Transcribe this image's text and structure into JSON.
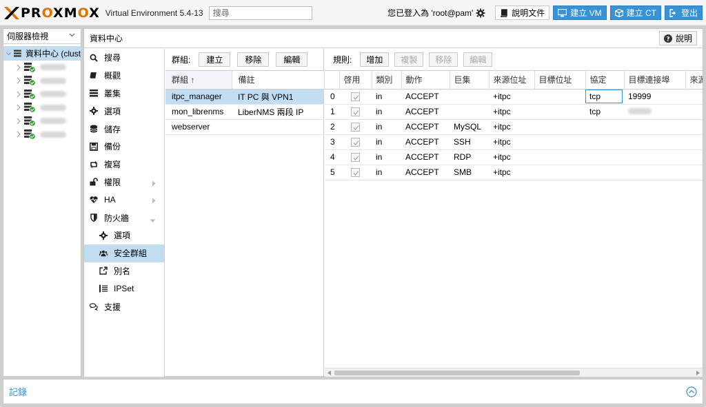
{
  "header": {
    "logo_pre": "PR",
    "logo_o1": "O",
    "logo_mid": "XM",
    "logo_o2": "O",
    "logo_post": "X",
    "version": "Virtual Environment 5.4-13",
    "search_placeholder": "搜尋",
    "user_text": "您已登入為 'root@pam'",
    "docs_label": "說明文件",
    "create_vm_label": "建立 VM",
    "create_ct_label": "建立 CT",
    "logout_label": "登出"
  },
  "tree": {
    "view": "伺服器檢視",
    "root_label": "資料中心 (clust",
    "node_count": 6
  },
  "content": {
    "title": "資料中心",
    "help_label": "說明"
  },
  "menu": [
    {
      "label": "搜尋",
      "icon": "search-icon",
      "sub": false,
      "active": false
    },
    {
      "label": "概觀",
      "icon": "book-icon",
      "sub": false,
      "active": false
    },
    {
      "label": "叢集",
      "icon": "server-icon",
      "sub": false,
      "active": false
    },
    {
      "label": "選項",
      "icon": "gear-icon",
      "sub": false,
      "active": false
    },
    {
      "label": "儲存",
      "icon": "database-icon",
      "sub": false,
      "active": false
    },
    {
      "label": "備份",
      "icon": "floppy-icon",
      "sub": false,
      "active": false
    },
    {
      "label": "複寫",
      "icon": "retweet-icon",
      "sub": false,
      "active": false
    },
    {
      "label": "權限",
      "icon": "unlock-icon",
      "sub": false,
      "active": false,
      "arrow": "right"
    },
    {
      "label": "HA",
      "icon": "heartbeat-icon",
      "sub": false,
      "active": false,
      "arrow": "right"
    },
    {
      "label": "防火牆",
      "icon": "shield-icon",
      "sub": false,
      "active": false,
      "arrow": "down"
    },
    {
      "label": "選項",
      "icon": "gear-icon",
      "sub": true,
      "active": false
    },
    {
      "label": "安全群組",
      "icon": "users-icon",
      "sub": true,
      "active": true
    },
    {
      "label": "別名",
      "icon": "external-link-icon",
      "sub": true,
      "active": false
    },
    {
      "label": "IPSet",
      "icon": "list-icon",
      "sub": true,
      "active": false
    },
    {
      "label": "支援",
      "icon": "comments-icon",
      "sub": false,
      "active": false
    }
  ],
  "groups": {
    "label": "群組:",
    "create": "建立",
    "remove": "移除",
    "edit": "編輯",
    "col_group": "群組 ↑",
    "col_comment": "備註",
    "rows": [
      {
        "name": "itpc_manager",
        "comment": "IT PC 與 VPN1"
      },
      {
        "name": "mon_librenms",
        "comment": "LiberNMS 兩段 IP"
      },
      {
        "name": "webserver",
        "comment": ""
      }
    ]
  },
  "rules": {
    "label": "規則:",
    "add": "增加",
    "copy": "複製",
    "remove": "移除",
    "edit": "編輯",
    "columns": [
      "啓用",
      "類別",
      "動作",
      "巨集",
      "來源位址",
      "目標位址",
      "協定",
      "目標連接埠",
      "來源"
    ],
    "rows": [
      {
        "num": "0",
        "type": "in",
        "action": "ACCEPT",
        "macro": "",
        "source": "+itpc",
        "dest": "",
        "proto": "tcp",
        "dport": "19999"
      },
      {
        "num": "1",
        "type": "in",
        "action": "ACCEPT",
        "macro": "",
        "source": "+itpc",
        "dest": "",
        "proto": "tcp",
        "dport": ""
      },
      {
        "num": "2",
        "type": "in",
        "action": "ACCEPT",
        "macro": "MySQL",
        "source": "+itpc",
        "dest": "",
        "proto": "",
        "dport": ""
      },
      {
        "num": "3",
        "type": "in",
        "action": "ACCEPT",
        "macro": "SSH",
        "source": "+itpc",
        "dest": "",
        "proto": "",
        "dport": ""
      },
      {
        "num": "4",
        "type": "in",
        "action": "ACCEPT",
        "macro": "RDP",
        "source": "+itpc",
        "dest": "",
        "proto": "",
        "dport": ""
      },
      {
        "num": "5",
        "type": "in",
        "action": "ACCEPT",
        "macro": "SMB",
        "source": "+itpc",
        "dest": "",
        "proto": "",
        "dport": ""
      }
    ]
  },
  "log": {
    "label": "記錄"
  },
  "colors": {
    "accent": "#3892d4",
    "selected": "#c2ddf2",
    "logo_orange": "#e57000"
  }
}
